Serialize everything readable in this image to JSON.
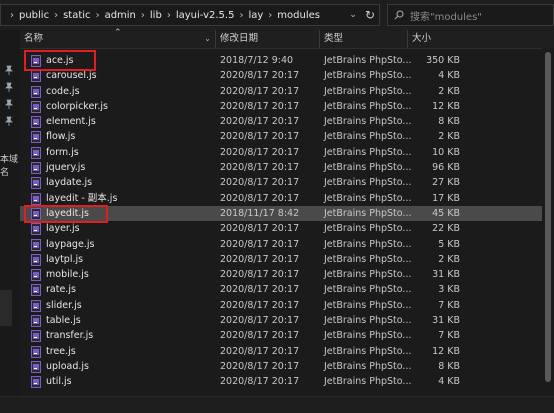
{
  "breadcrumb": [
    "public",
    "static",
    "admin",
    "lib",
    "layui-v2.5.5",
    "lay",
    "modules"
  ],
  "search_placeholder": "搜索\"modules\"",
  "nav": {
    "partial_label": "本域名"
  },
  "columns": {
    "name": "名称",
    "date": "修改日期",
    "type": "类型",
    "size": "大小"
  },
  "files": [
    {
      "name": "ace.js",
      "date": "2018/7/12 9:40",
      "type": "JetBrains PhpSto...",
      "size": "350 KB"
    },
    {
      "name": "carousel.js",
      "date": "2020/8/17 20:17",
      "type": "JetBrains PhpSto...",
      "size": "4 KB"
    },
    {
      "name": "code.js",
      "date": "2020/8/17 20:17",
      "type": "JetBrains PhpSto...",
      "size": "2 KB"
    },
    {
      "name": "colorpicker.js",
      "date": "2020/8/17 20:17",
      "type": "JetBrains PhpSto...",
      "size": "12 KB"
    },
    {
      "name": "element.js",
      "date": "2020/8/17 20:17",
      "type": "JetBrains PhpSto...",
      "size": "8 KB"
    },
    {
      "name": "flow.js",
      "date": "2020/8/17 20:17",
      "type": "JetBrains PhpSto...",
      "size": "2 KB"
    },
    {
      "name": "form.js",
      "date": "2020/8/17 20:17",
      "type": "JetBrains PhpSto...",
      "size": "10 KB"
    },
    {
      "name": "jquery.js",
      "date": "2020/8/17 20:17",
      "type": "JetBrains PhpSto...",
      "size": "96 KB"
    },
    {
      "name": "laydate.js",
      "date": "2020/8/17 20:17",
      "type": "JetBrains PhpSto...",
      "size": "27 KB"
    },
    {
      "name": "layedit - 副本.js",
      "date": "2020/8/17 20:17",
      "type": "JetBrains PhpSto...",
      "size": "17 KB"
    },
    {
      "name": "layedit.js",
      "date": "2018/11/17 8:42",
      "type": "JetBrains PhpSto...",
      "size": "45 KB"
    },
    {
      "name": "layer.js",
      "date": "2020/8/17 20:17",
      "type": "JetBrains PhpSto...",
      "size": "22 KB"
    },
    {
      "name": "laypage.js",
      "date": "2020/8/17 20:17",
      "type": "JetBrains PhpSto...",
      "size": "5 KB"
    },
    {
      "name": "laytpl.js",
      "date": "2020/8/17 20:17",
      "type": "JetBrains PhpSto...",
      "size": "2 KB"
    },
    {
      "name": "mobile.js",
      "date": "2020/8/17 20:17",
      "type": "JetBrains PhpSto...",
      "size": "31 KB"
    },
    {
      "name": "rate.js",
      "date": "2020/8/17 20:17",
      "type": "JetBrains PhpSto...",
      "size": "3 KB"
    },
    {
      "name": "slider.js",
      "date": "2020/8/17 20:17",
      "type": "JetBrains PhpSto...",
      "size": "7 KB"
    },
    {
      "name": "table.js",
      "date": "2020/8/17 20:17",
      "type": "JetBrains PhpSto...",
      "size": "31 KB"
    },
    {
      "name": "transfer.js",
      "date": "2020/8/17 20:17",
      "type": "JetBrains PhpSto...",
      "size": "7 KB"
    },
    {
      "name": "tree.js",
      "date": "2020/8/17 20:17",
      "type": "JetBrains PhpSto...",
      "size": "12 KB"
    },
    {
      "name": "upload.js",
      "date": "2020/8/17 20:17",
      "type": "JetBrains PhpSto...",
      "size": "8 KB"
    },
    {
      "name": "util.js",
      "date": "2020/8/17 20:17",
      "type": "JetBrains PhpSto...",
      "size": "4 KB"
    }
  ],
  "selected_file": "layedit.js",
  "highlighted_files": [
    "ace.js",
    "layedit.js"
  ],
  "colors": {
    "background": "#1b1b1b",
    "selection": "#4a4a4a",
    "highlight": "#e02020",
    "file_icon": "#7b5cc6"
  },
  "icons": {
    "file": "phpstorm-js-file-icon",
    "pin": "pin-icon",
    "search": "search-icon",
    "refresh": "refresh-icon"
  }
}
